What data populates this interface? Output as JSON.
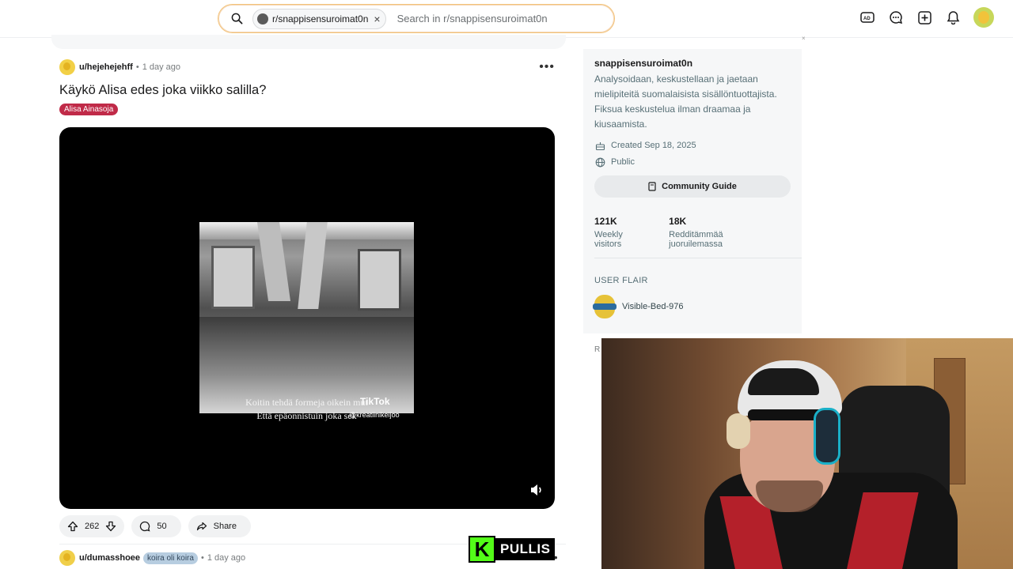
{
  "header": {
    "community_chip": "r/snappisensuroimat0n",
    "search_placeholder": "Search in r/snappisensuroimat0n"
  },
  "post": {
    "username": "u/hejehejehff",
    "time": "1 day ago",
    "title": "Käykö Alisa edes joka viikko salilla?",
    "flair": "Alisa Ainasoja",
    "video": {
      "caption_line1": "Koitin tehdä formeja oikein mut",
      "caption_line2": "Että epäonnistuin joka sek",
      "tiktok_label": "TikTok",
      "tiktok_handle": "@kreatiinikeijoo"
    },
    "votes": "262",
    "comments": "50",
    "share_label": "Share"
  },
  "post2": {
    "username": "u/dumasshoee",
    "flair": "koira oli koira",
    "time": "1 day ago"
  },
  "sidebar": {
    "name": "snappisensuroimat0n",
    "description": "Analysoidaan, keskustellaan ja jaetaan mielipiteitä suomalaisista sisällöntuottajista. Fiksua keskustelua ilman draamaa ja kiusaamista.",
    "created": "Created Sep 18, 2025",
    "visibility": "Public",
    "guide_button": "Community Guide",
    "stats": [
      {
        "value": "121K",
        "label": "Weekly visitors"
      },
      {
        "value": "18K",
        "label": "Redditämmää juoruilemassa"
      }
    ],
    "user_flair_heading": "USER FLAIR",
    "user_flair_name": "Visible-Bed-976",
    "partial_letter": "R"
  },
  "overlay": {
    "badge_letter": "K",
    "badge_name": "PULLIS"
  },
  "colors": {
    "flair_red": "#c02a48",
    "kick_green": "#53fc18"
  }
}
